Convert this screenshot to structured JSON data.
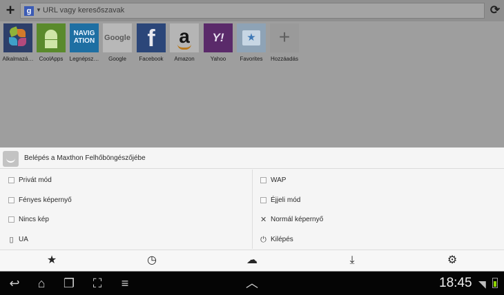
{
  "url_bar": {
    "placeholder": "URL vagy keresőszavak"
  },
  "speed_dial": [
    {
      "label": "Alkalmazá…"
    },
    {
      "label": "CoolApps"
    },
    {
      "label": "Legnépsz…",
      "tile_text": "NAVIG ATION"
    },
    {
      "label": "Google",
      "tile_text": "Google"
    },
    {
      "label": "Facebook",
      "tile_text": "f"
    },
    {
      "label": "Amazon",
      "tile_text": "a"
    },
    {
      "label": "Yahoo",
      "tile_text": "Y!"
    },
    {
      "label": "Favorites"
    },
    {
      "label": "Hozzáadás"
    }
  ],
  "menu": {
    "login": "Belépés a Maxthon Felhőböngészőjébe",
    "left_options": [
      "Privát mód",
      "Fényes képernyő",
      "Nincs kép",
      "UA"
    ],
    "right_options": [
      "WAP",
      "Éjjeli mód",
      "Normál képernyő",
      "Kilépés"
    ]
  },
  "toolbar_icons": [
    "star-icon",
    "history-clock-icon",
    "cloud-icon",
    "download-icon",
    "gear-icon"
  ],
  "status": {
    "time": "18:45"
  },
  "colors": {
    "accent_battery": "#8fd400",
    "sheet_bg": "#f5f5f5"
  }
}
